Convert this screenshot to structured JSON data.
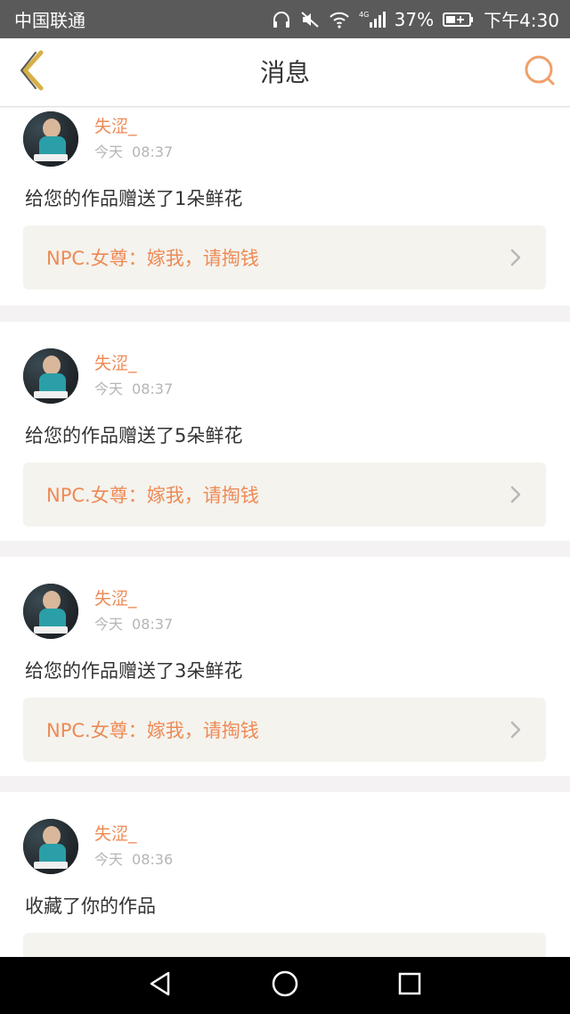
{
  "status_bar": {
    "carrier": "中国联通",
    "network": "4G",
    "battery_percent": "37%",
    "time": "下午4:30",
    "icons": [
      "headphones-icon",
      "mute-icon",
      "wifi-icon",
      "signal-icon",
      "battery-icon"
    ]
  },
  "header": {
    "title": "消息",
    "back_icon": "chevron-left-icon",
    "search_icon": "search-icon"
  },
  "messages": [
    {
      "user": "失涩_",
      "day": "今天",
      "time": "08:37",
      "text": "给您的作品赠送了1朵鲜花",
      "quote": "NPC.女尊：嫁我，请掏钱"
    },
    {
      "user": "失涩_",
      "day": "今天",
      "time": "08:37",
      "text": "给您的作品赠送了5朵鲜花",
      "quote": "NPC.女尊：嫁我，请掏钱"
    },
    {
      "user": "失涩_",
      "day": "今天",
      "time": "08:37",
      "text": "给您的作品赠送了3朵鲜花",
      "quote": "NPC.女尊：嫁我，请掏钱"
    },
    {
      "user": "失涩_",
      "day": "今天",
      "time": "08:36",
      "text": "收藏了你的作品",
      "quote": ""
    }
  ],
  "colors": {
    "accent": "#ee8a55",
    "status_bar": "#5a5a5a",
    "nav_bar": "#000000",
    "back_icon": "#d6b046"
  },
  "nav": {
    "icons": [
      "back-triangle-icon",
      "home-circle-icon",
      "recents-square-icon"
    ]
  }
}
